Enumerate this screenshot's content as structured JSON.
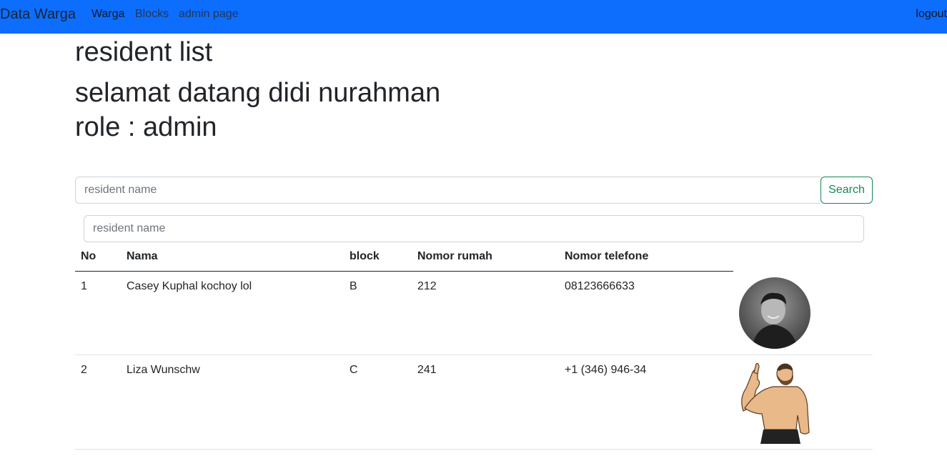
{
  "navbar": {
    "brand": "Data Warga",
    "links": [
      "Warga",
      "Blocks",
      "admin page"
    ],
    "logout": "logout",
    "bg_color": "#0d6efd"
  },
  "page": {
    "title": "resident list",
    "welcome": "selamat datang didi nurahman",
    "role": "role : admin"
  },
  "search": {
    "placeholder": "resident name",
    "button_label": "Search",
    "filter_placeholder": "resident name"
  },
  "table": {
    "headers": [
      "No",
      "Nama",
      "block",
      "Nomor rumah",
      "Nomor telefone"
    ],
    "rows": [
      {
        "no": "1",
        "nama": "Casey Kuphal kochoy lol",
        "block": "B",
        "nomor_rumah": "212",
        "telefone": "08123666633",
        "photo": "person-photo"
      },
      {
        "no": "2",
        "nama": "Liza Wunschw",
        "block": "C",
        "nomor_rumah": "241",
        "telefone": "+1 (346) 946-34",
        "photo": "thumbs-up-man-illustration"
      }
    ]
  },
  "colors": {
    "accent": "#0d6efd",
    "success": "#198754"
  }
}
